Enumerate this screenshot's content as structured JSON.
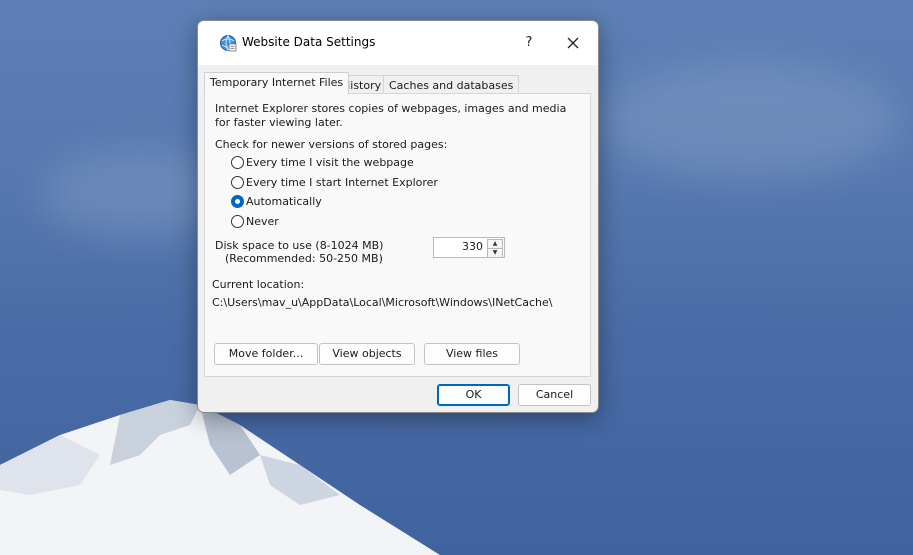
{
  "window": {
    "title": "Website Data Settings",
    "help_label": "?",
    "close_icon": "close-icon",
    "app_icon": "ie-globe-icon"
  },
  "tabs": [
    {
      "label": "Temporary Internet Files",
      "active": true
    },
    {
      "label": "History",
      "active": false
    },
    {
      "label": "Caches and databases",
      "active": false
    }
  ],
  "panel": {
    "description_line1": "Internet Explorer stores copies of webpages, images and media",
    "description_line2": "for faster viewing later.",
    "check_label": "Check for newer versions of stored pages:",
    "options": [
      {
        "label": "Every time I visit the webpage",
        "checked": false
      },
      {
        "label": "Every time I start Internet Explorer",
        "checked": false
      },
      {
        "label": "Automatically",
        "checked": true
      },
      {
        "label": "Never",
        "checked": false
      }
    ],
    "disk_label_line1": "Disk space to use (8-1024 MB)",
    "disk_label_line2": "(Recommended: 50-250 MB)",
    "disk_value": "330",
    "location_label": "Current location:",
    "location_path": "C:\\Users\\mav_u\\AppData\\Local\\Microsoft\\Windows\\INetCache\\",
    "move_folder_label": "Move folder...",
    "view_objects_label": "View objects",
    "view_files_label": "View files"
  },
  "footer": {
    "ok_label": "OK",
    "cancel_label": "Cancel"
  },
  "colors": {
    "accent": "#0067c0",
    "desktop_sky": "#4a6ca6"
  }
}
